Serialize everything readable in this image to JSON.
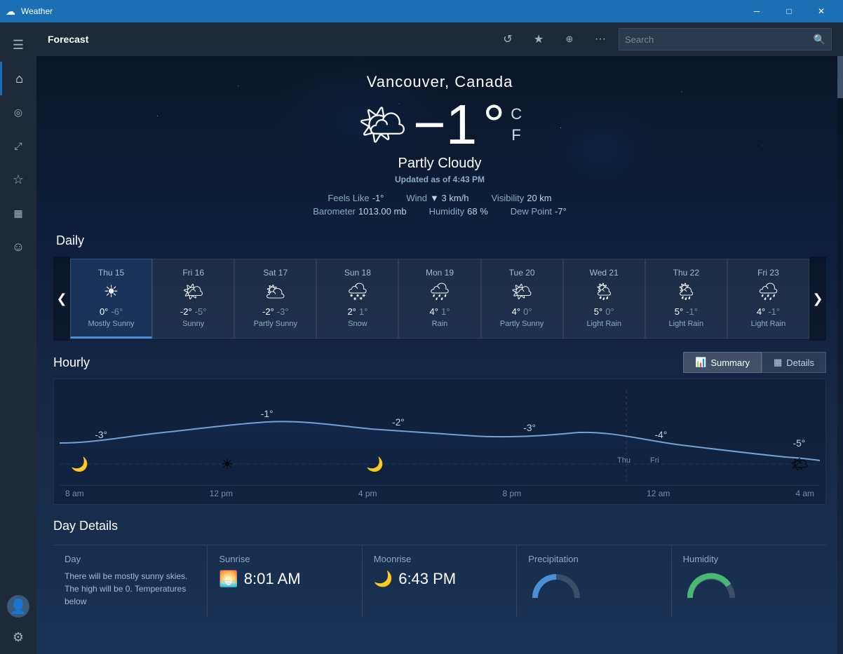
{
  "titleBar": {
    "icon": "☁",
    "title": "Weather",
    "minimize": "─",
    "maximize": "□",
    "close": "✕"
  },
  "topBar": {
    "title": "Forecast",
    "refresh_label": "↺",
    "favorite_label": "★",
    "pin_label": "⊞",
    "more_label": "···",
    "search_placeholder": "Search"
  },
  "sidebar": {
    "items": [
      {
        "id": "menu",
        "icon": "☰",
        "active": false
      },
      {
        "id": "home",
        "icon": "⌂",
        "active": true
      },
      {
        "id": "radar",
        "icon": "◎",
        "active": false
      },
      {
        "id": "maps",
        "icon": "📈",
        "active": false
      },
      {
        "id": "favorites",
        "icon": "★",
        "active": false
      },
      {
        "id": "news",
        "icon": "▦",
        "active": false
      },
      {
        "id": "emoji",
        "icon": "☺",
        "active": false
      }
    ],
    "bottomItems": [
      {
        "id": "avatar",
        "icon": "👤",
        "active": false
      },
      {
        "id": "settings",
        "icon": "⚙",
        "active": false
      }
    ]
  },
  "currentWeather": {
    "city": "Vancouver, Canada",
    "icon": "🌤",
    "temperature": "−1",
    "unit_c": "C",
    "unit_f": "F",
    "condition": "Partly Cloudy",
    "updated": "Updated as of 4:43 PM",
    "feels_like_label": "Feels Like",
    "feels_like_value": "-1°",
    "wind_label": "Wind",
    "wind_value": "▼ 3 km/h",
    "visibility_label": "Visibility",
    "visibility_value": "20 km",
    "barometer_label": "Barometer",
    "barometer_value": "1013.00 mb",
    "humidity_label": "Humidity",
    "humidity_value": "68 %",
    "dew_point_label": "Dew Point",
    "dew_point_value": "-7°"
  },
  "daily": {
    "title": "Daily",
    "prev_btn": "❮",
    "next_btn": "❯",
    "cards": [
      {
        "day": "Thu 15",
        "icon": "☀",
        "high": "0°",
        "low": "-6°",
        "condition": "Mostly Sunny",
        "active": true
      },
      {
        "day": "Fri 16",
        "icon": "🌤",
        "high": "-2°",
        "low": "-5°",
        "condition": "Sunny",
        "active": false
      },
      {
        "day": "Sat 17",
        "icon": "🌥",
        "high": "-2°",
        "low": "-3°",
        "condition": "Partly Sunny",
        "active": false
      },
      {
        "day": "Sun 18",
        "icon": "🌨",
        "high": "2°",
        "low": "1°",
        "condition": "Snow",
        "active": false
      },
      {
        "day": "Mon 19",
        "icon": "🌧",
        "high": "4°",
        "low": "1°",
        "condition": "Rain",
        "active": false
      },
      {
        "day": "Tue 20",
        "icon": "🌤",
        "high": "4°",
        "low": "0°",
        "condition": "Partly Sunny",
        "active": false
      },
      {
        "day": "Wed 21",
        "icon": "🌦",
        "high": "5°",
        "low": "0°",
        "condition": "Light Rain",
        "active": false
      },
      {
        "day": "Thu 22",
        "icon": "🌦",
        "high": "5°",
        "low": "-1°",
        "condition": "Light Rain",
        "active": false
      },
      {
        "day": "Fri 23",
        "icon": "🌧",
        "high": "4°",
        "low": "-1°",
        "condition": "Light Rain",
        "active": false
      }
    ]
  },
  "hourly": {
    "title": "Hourly",
    "summary_btn": "Summary",
    "details_btn": "Details",
    "chart_icon": "📊",
    "details_icon": "▦",
    "temps": [
      {
        "label": "8 am",
        "value": "-3°",
        "icon": "🌙"
      },
      {
        "label": "12 pm",
        "value": "-1°",
        "icon": "☀"
      },
      {
        "label": "4 pm",
        "value": "-2°",
        "icon": "🌙"
      },
      {
        "label": "8 pm",
        "value": "-3°",
        "icon": null
      },
      {
        "label": "12 am",
        "value": "-4°",
        "icon": null
      },
      {
        "label": "4 am",
        "value": "-5°",
        "icon": "🌤"
      }
    ],
    "thu_label": "Thu",
    "fri_label": "Fri"
  },
  "dayDetails": {
    "title": "Day Details",
    "columns": [
      {
        "title": "Day",
        "icon": null,
        "time": null,
        "text": "There will be mostly sunny skies. The high will be 0. Temperatures below"
      },
      {
        "title": "Sunrise",
        "icon": "🌅",
        "time": "8:01 AM",
        "text": null
      },
      {
        "title": "Moonrise",
        "icon": "🌙",
        "time": "6:43 PM",
        "text": null
      },
      {
        "title": "Precipitation",
        "icon": null,
        "time": null,
        "text": null
      },
      {
        "title": "Humidity",
        "icon": null,
        "time": null,
        "text": null
      }
    ]
  }
}
